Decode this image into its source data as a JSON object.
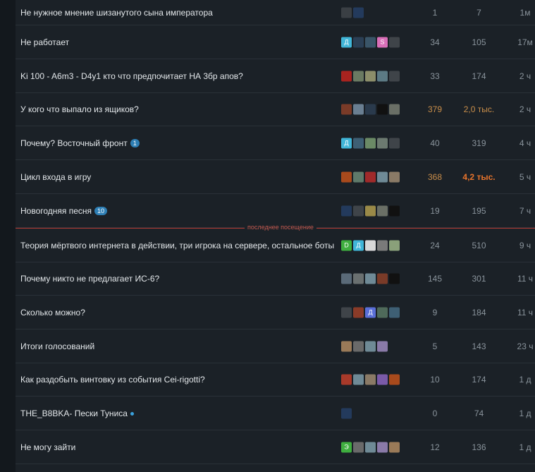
{
  "divider_label": "последнее посещение",
  "topics": [
    {
      "title": "Не нужное мнение шизанутого сына императора",
      "badge": "",
      "dot": false,
      "avatars": [
        {
          "t": "",
          "c": "#3a3f44"
        },
        {
          "t": "",
          "c": "#233a5c"
        }
      ],
      "replies": "1",
      "views": "7",
      "activity": "1м",
      "hot": ""
    },
    {
      "title": "Не работает",
      "badge": "",
      "dot": false,
      "avatars": [
        {
          "t": "Д",
          "c": "#41b6d8"
        },
        {
          "t": "",
          "c": "#2b3f55"
        },
        {
          "t": "",
          "c": "#3a5568"
        },
        {
          "t": "S",
          "c": "#d96fb8"
        },
        {
          "t": "",
          "c": "#3f4449"
        }
      ],
      "replies": "34",
      "views": "105",
      "activity": "17м",
      "hot": ""
    },
    {
      "title": "Ki 100 - A6m3 - D4y1 кто что предпочитает НА 3бр апов?",
      "badge": "",
      "dot": false,
      "avatars": [
        {
          "t": "",
          "c": "#a8231f"
        },
        {
          "t": "",
          "c": "#6a7a62"
        },
        {
          "t": "",
          "c": "#8c8e6a"
        },
        {
          "t": "",
          "c": "#5c7a84"
        },
        {
          "t": "",
          "c": "#3f4449"
        }
      ],
      "replies": "33",
      "views": "174",
      "activity": "2 ч",
      "hot": ""
    },
    {
      "title": "У кого что выпало из ящиков?",
      "badge": "",
      "dot": false,
      "avatars": [
        {
          "t": "",
          "c": "#7a3b28"
        },
        {
          "t": "",
          "c": "#6a7f92"
        },
        {
          "t": "",
          "c": "#2a3a4c"
        },
        {
          "t": "",
          "c": "#111111"
        },
        {
          "t": "",
          "c": "#6a6f66"
        }
      ],
      "replies": "379",
      "views": "2,0 тыс.",
      "activity": "2 ч",
      "hot": "hot"
    },
    {
      "title": "Почему? Восточный фронт",
      "badge": "1",
      "dot": false,
      "avatars": [
        {
          "t": "Д",
          "c": "#41b6d8"
        },
        {
          "t": "",
          "c": "#3e5f74"
        },
        {
          "t": "",
          "c": "#6b8a66"
        },
        {
          "t": "",
          "c": "#6c7a70"
        },
        {
          "t": "",
          "c": "#3f4449"
        }
      ],
      "replies": "40",
      "views": "319",
      "activity": "4 ч",
      "hot": ""
    },
    {
      "title": "Цикл входа в игру",
      "badge": "",
      "dot": false,
      "avatars": [
        {
          "t": "",
          "c": "#a84a1c"
        },
        {
          "t": "",
          "c": "#5f7a6a"
        },
        {
          "t": "",
          "c": "#a02a2a"
        },
        {
          "t": "",
          "c": "#6f8a96"
        },
        {
          "t": "",
          "c": "#8a7a66"
        }
      ],
      "replies": "368",
      "views": "4,2 тыс.",
      "activity": "5 ч",
      "hot": "hotter"
    },
    {
      "title": "Новогодняя песня",
      "badge": "10",
      "dot": false,
      "avatars": [
        {
          "t": "",
          "c": "#233a5c"
        },
        {
          "t": "",
          "c": "#3f4449"
        },
        {
          "t": "",
          "c": "#9a8a48"
        },
        {
          "t": "",
          "c": "#6a6f66"
        },
        {
          "t": "",
          "c": "#111111"
        }
      ],
      "replies": "19",
      "views": "195",
      "activity": "7 ч",
      "hot": ""
    },
    {
      "title": "Теория мёртвого интернета в действии, три игрока на сервере, остальное боты",
      "badge": "",
      "dot": false,
      "avatars": [
        {
          "t": "D",
          "c": "#3fae3f"
        },
        {
          "t": "Д",
          "c": "#41b6d8"
        },
        {
          "t": "",
          "c": "#d8d8d8"
        },
        {
          "t": "",
          "c": "#7a7a7a"
        },
        {
          "t": "",
          "c": "#8aa07a"
        }
      ],
      "replies": "24",
      "views": "510",
      "activity": "9 ч",
      "hot": ""
    },
    {
      "title": "Почему никто не предлагает ИС-6?",
      "badge": "",
      "dot": false,
      "avatars": [
        {
          "t": "",
          "c": "#5a6a78"
        },
        {
          "t": "",
          "c": "#6a7070"
        },
        {
          "t": "",
          "c": "#6f8a96"
        },
        {
          "t": "",
          "c": "#7a3b28"
        },
        {
          "t": "",
          "c": "#111111"
        }
      ],
      "replies": "145",
      "views": "301",
      "activity": "11 ч",
      "hot": ""
    },
    {
      "title": "Сколько можно?",
      "badge": "",
      "dot": false,
      "avatars": [
        {
          "t": "",
          "c": "#3f4449"
        },
        {
          "t": "",
          "c": "#8a3b28"
        },
        {
          "t": "Д",
          "c": "#5a6fd8"
        },
        {
          "t": "",
          "c": "#4f6a5a"
        },
        {
          "t": "",
          "c": "#3e5f74"
        }
      ],
      "replies": "9",
      "views": "184",
      "activity": "11 ч",
      "hot": ""
    },
    {
      "title": "Итоги голосований",
      "badge": "",
      "dot": false,
      "avatars": [
        {
          "t": "",
          "c": "#9a7a58"
        },
        {
          "t": "",
          "c": "#6a6a6a"
        },
        {
          "t": "",
          "c": "#6f8a96"
        },
        {
          "t": "",
          "c": "#8a7aa8"
        }
      ],
      "replies": "5",
      "views": "143",
      "activity": "23 ч",
      "hot": ""
    },
    {
      "title": "Как раздобыть винтовку из события Cei-rigotti?",
      "badge": "",
      "dot": false,
      "avatars": [
        {
          "t": "",
          "c": "#a83a2a"
        },
        {
          "t": "",
          "c": "#6f8a96"
        },
        {
          "t": "",
          "c": "#8a7a66"
        },
        {
          "t": "",
          "c": "#7a5aa8"
        },
        {
          "t": "",
          "c": "#a84a1c"
        }
      ],
      "replies": "10",
      "views": "174",
      "activity": "1 д",
      "hot": ""
    },
    {
      "title": "THE_B8BKA- Пески Туниса",
      "badge": "",
      "dot": true,
      "avatars": [
        {
          "t": "",
          "c": "#233a5c"
        }
      ],
      "replies": "0",
      "views": "74",
      "activity": "1 д",
      "hot": ""
    },
    {
      "title": "Не могу зайти",
      "badge": "",
      "dot": false,
      "avatars": [
        {
          "t": "Э",
          "c": "#3fae3f"
        },
        {
          "t": "",
          "c": "#6a6a6a"
        },
        {
          "t": "",
          "c": "#6f8a96"
        },
        {
          "t": "",
          "c": "#8a7aa8"
        },
        {
          "t": "",
          "c": "#9a7a58"
        }
      ],
      "replies": "12",
      "views": "136",
      "activity": "1 д",
      "hot": ""
    }
  ]
}
